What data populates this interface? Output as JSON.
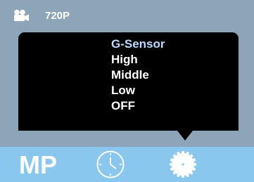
{
  "status": {
    "mode_icon": "video-camera-icon",
    "resolution": "720P"
  },
  "menu": {
    "title": "G-Sensor",
    "options": [
      "High",
      "Middle",
      "Low",
      "OFF"
    ]
  },
  "bottom_bar": {
    "mode_label": "MP",
    "icons": [
      "clock-icon",
      "settings-icon"
    ]
  },
  "colors": {
    "screen_background": "#8da5b8",
    "bottom_bar": "#89c7ef",
    "popup": "#000000",
    "menu_title": "#b9dcff",
    "text": "#ffffff"
  }
}
